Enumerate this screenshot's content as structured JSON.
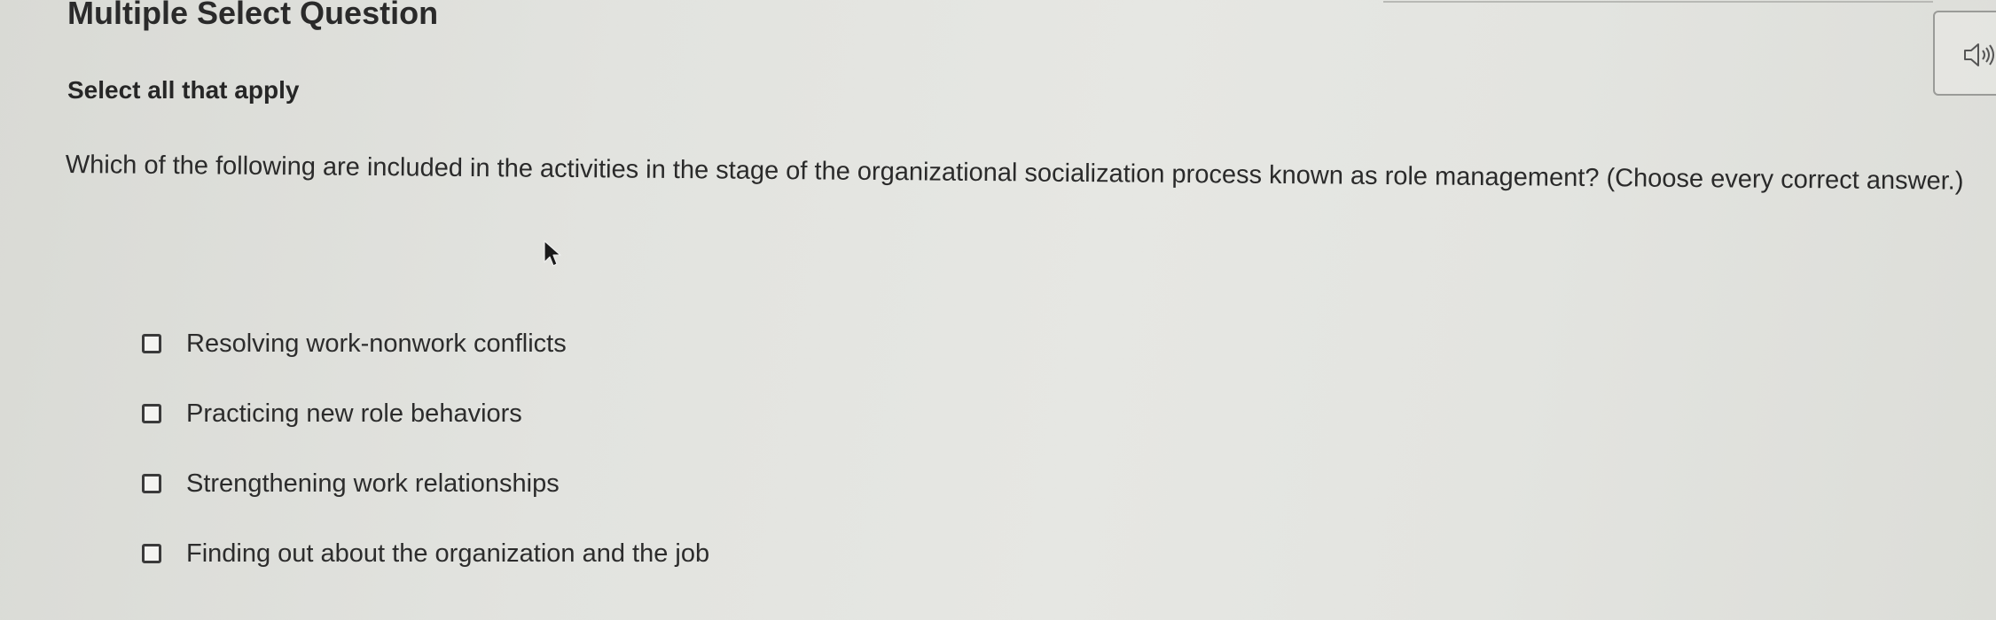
{
  "header": {
    "title": "Multiple Select Question",
    "instruction": "Select all that apply"
  },
  "question": {
    "text": "Which of the following are included in the activities in the stage of the organizational socialization process known as role management? (Choose every correct answer.)"
  },
  "options": [
    {
      "label": "Resolving work-nonwork conflicts",
      "checked": false
    },
    {
      "label": "Practicing new role behaviors",
      "checked": false
    },
    {
      "label": "Strengthening work relationships",
      "checked": false
    },
    {
      "label": "Finding out about the organization and the job",
      "checked": false
    }
  ],
  "icons": {
    "audio": "speaker-icon",
    "cursor": "mouse-pointer-icon"
  }
}
